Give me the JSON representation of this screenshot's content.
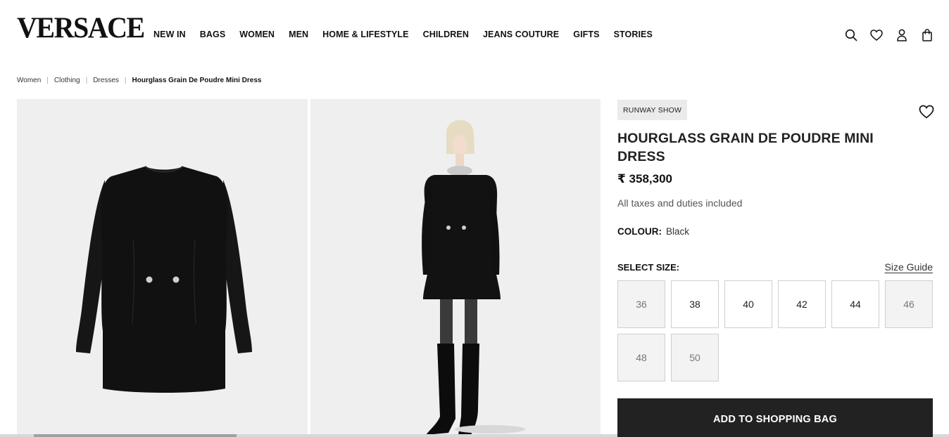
{
  "brand": {
    "logo": "VERSACE"
  },
  "nav": [
    "NEW IN",
    "BAGS",
    "WOMEN",
    "MEN",
    "HOME & LIFESTYLE",
    "CHILDREN",
    "JEANS COUTURE",
    "GIFTS",
    "STORIES"
  ],
  "header_icons": [
    "search-icon",
    "heart-icon",
    "user-icon",
    "shopping-bag-icon"
  ],
  "breadcrumb": {
    "items": [
      "Women",
      "Clothing",
      "Dresses"
    ],
    "current": "Hourglass Grain De Poudre Mini Dress"
  },
  "gallery": {
    "images": [
      "dress-flat-lay",
      "model-wearing-dress"
    ]
  },
  "product": {
    "badge": "RUNWAY SHOW",
    "title": "HOURGLASS GRAIN DE POUDRE MINI DRESS",
    "price": "₹ 358,300",
    "tax_note": "All taxes and duties included",
    "colour_label": "COLOUR:",
    "colour_value": "Black",
    "select_size_label": "SELECT SIZE:",
    "size_guide_label": "Size Guide",
    "sizes": [
      {
        "label": "36",
        "available": false
      },
      {
        "label": "38",
        "available": true
      },
      {
        "label": "40",
        "available": true
      },
      {
        "label": "42",
        "available": true
      },
      {
        "label": "44",
        "available": true
      },
      {
        "label": "46",
        "available": false
      },
      {
        "label": "48",
        "available": false
      },
      {
        "label": "50",
        "available": false
      }
    ],
    "add_to_bag_label": "ADD TO SHOPPING BAG"
  },
  "colors": {
    "button_bg": "#222222",
    "gallery_bg": "#efefef"
  }
}
